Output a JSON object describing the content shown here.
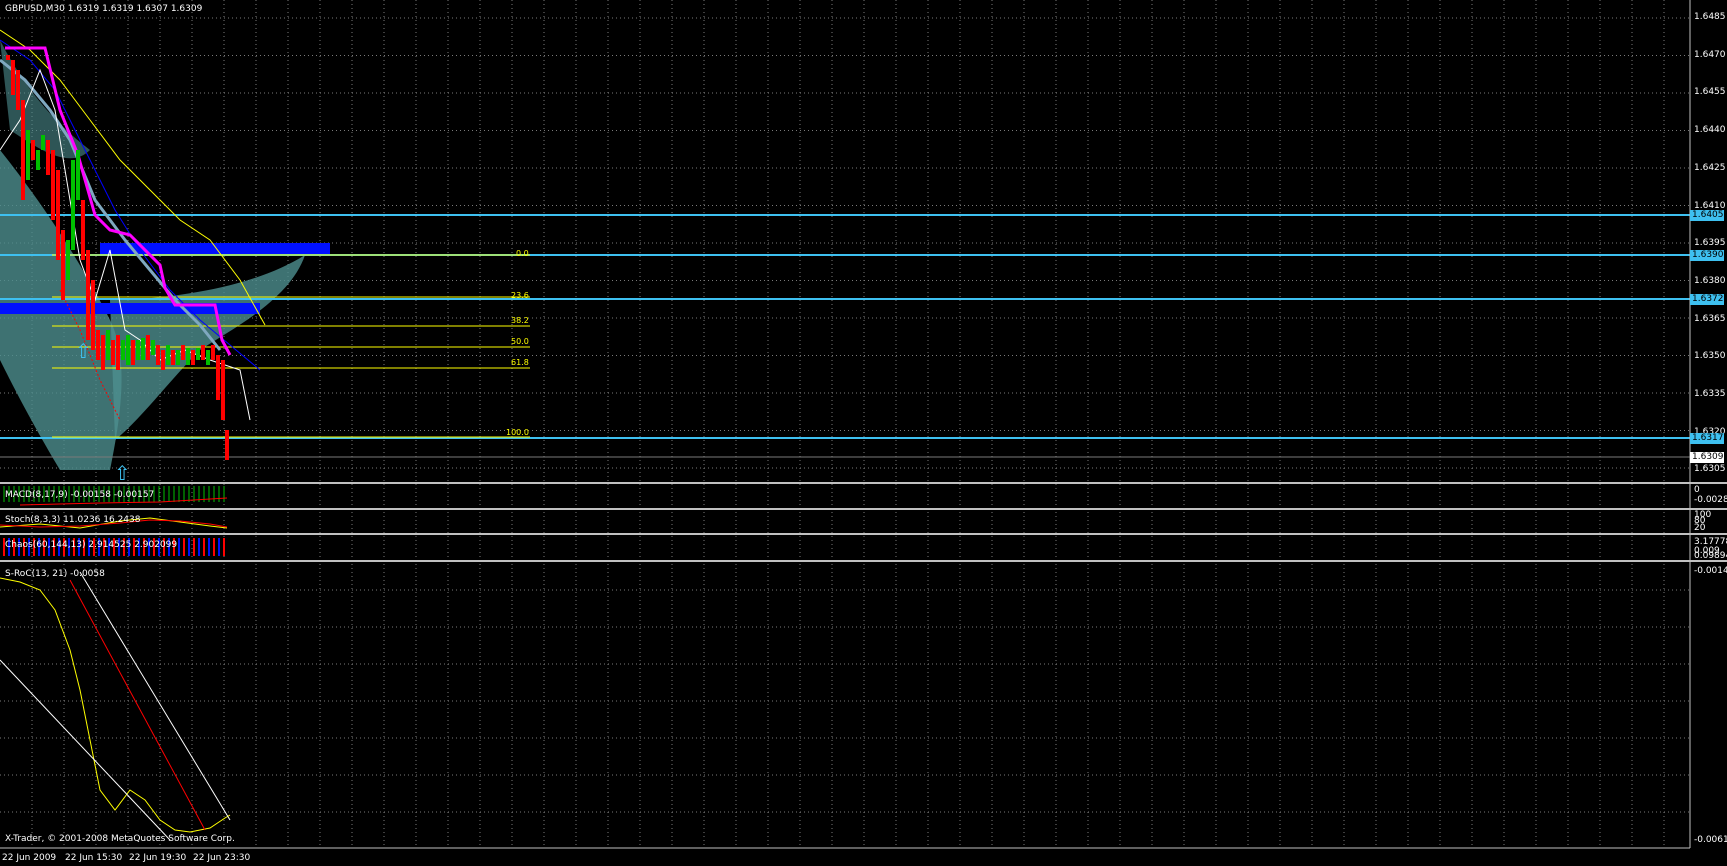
{
  "header": {
    "symbol": "GBPUSD,M30",
    "ohlc": "1.6319 1.6319 1.6307 1.6309"
  },
  "colors": {
    "background": "#000000",
    "grid": "#8a8a8a",
    "level_line": "#3ec0f0",
    "fib": "#ffff00",
    "bull_candle": "#00c000",
    "bear_candle": "#ff0000",
    "ma_magenta": "#ff00ff",
    "ma_blue": "#0000ff",
    "ma_yellow": "#ffff00",
    "accent_zone": "#0010ff"
  },
  "price_axis": {
    "ticks": [
      "1.6485",
      "1.6470",
      "1.6455",
      "1.6440",
      "1.6425",
      "1.6410",
      "1.6395",
      "1.6380",
      "1.6365",
      "1.6350",
      "1.6335",
      "1.6320",
      "1.6305"
    ],
    "highlighted": [
      "1.6405",
      "1.6390",
      "1.6372",
      "1.6317"
    ],
    "current": "1.6309"
  },
  "fibonacci": {
    "levels": [
      "0.0",
      "23.6",
      "38.2",
      "50.0",
      "61.8",
      "100.0"
    ]
  },
  "indicators": {
    "macd": {
      "label": "MACD(8,17,9) -0.00158 -0.00157",
      "axis_top": "0",
      "axis_bottom": "-0.00281"
    },
    "stoch": {
      "label": "Stoch(8,3,3) 11.0236 16.2438",
      "axis_top": "100",
      "axis_mid": "80",
      "axis_low": "20"
    },
    "chaos": {
      "label": "Chaos(60,144,13) 2.914525 2.902099",
      "axis_top": "3.177789",
      "axis_mid": "0.009",
      "axis_bottom": "0.09894"
    },
    "sroc": {
      "label": "S-RoC(13, 21) -0.0058",
      "axis_top": "-0.0014",
      "axis_bottom": "-0.0061"
    }
  },
  "footer": {
    "copyright": "X-Trader, © 2001-2008 MetaQuotes Software Corp."
  },
  "time_axis": [
    "22 Jun 2009",
    "22 Jun 15:30",
    "22 Jun 19:30",
    "22 Jun 23:30"
  ]
}
